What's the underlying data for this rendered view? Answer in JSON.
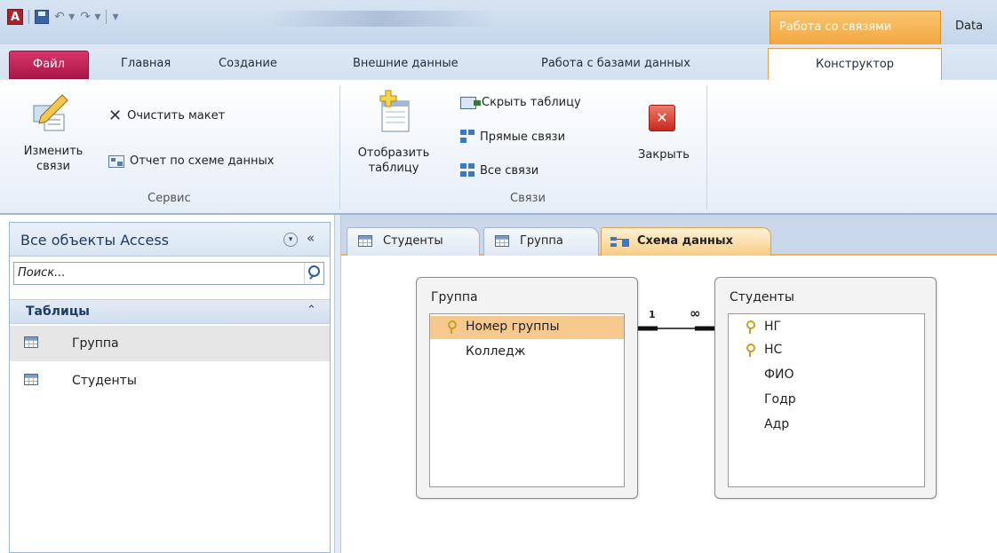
{
  "titlebar": {
    "app_icon": "A",
    "context_tab": "Работа со связями",
    "data_tab": "Data"
  },
  "ribbon_tabs": {
    "file": "Файл",
    "home": "Главная",
    "create": "Создание",
    "external": "Внешние данные",
    "database_tools": "Работа с базами данных",
    "designer": "Конструктор"
  },
  "ribbon": {
    "service": {
      "label": "Сервис",
      "edit_relations_line1": "Изменить",
      "edit_relations_line2": "связи",
      "clear_layout": "Очистить макет",
      "schema_report": "Отчет по схеме данных"
    },
    "relations": {
      "label": "Связи",
      "show_table_line1": "Отобразить",
      "show_table_line2": "таблицу",
      "hide_table": "Скрыть таблицу",
      "direct_relations": "Прямые связи",
      "all_relations": "Все связи",
      "close": "Закрыть"
    }
  },
  "nav": {
    "title": "Все объекты Access",
    "search_placeholder": "Поиск...",
    "group": "Таблицы",
    "items": [
      {
        "label": "Группа",
        "selected": true
      },
      {
        "label": "Студенты",
        "selected": false
      }
    ]
  },
  "doc_tabs": [
    {
      "label": "Студенты",
      "icon": "table-icon"
    },
    {
      "label": "Группа",
      "icon": "table-icon"
    },
    {
      "label": "Схема данных",
      "icon": "relationship-icon",
      "active": true
    }
  ],
  "diagram": {
    "tables": [
      {
        "name": "Группа",
        "fields": [
          {
            "name": "Номер группы",
            "key": true,
            "highlighted": true
          },
          {
            "name": "Колледж",
            "key": false
          }
        ]
      },
      {
        "name": "Студенты",
        "fields": [
          {
            "name": "НГ",
            "key": true
          },
          {
            "name": "НС",
            "key": true
          },
          {
            "name": "ФИО",
            "key": false
          },
          {
            "name": "Годр",
            "key": false
          },
          {
            "name": "Адр",
            "key": false
          }
        ]
      }
    ],
    "relation": {
      "from_card": "1",
      "to_card": "∞"
    }
  },
  "colors": {
    "file_tab": "#c0204f",
    "context_accent": "#f3a740",
    "highlight": "#f8c98e"
  }
}
